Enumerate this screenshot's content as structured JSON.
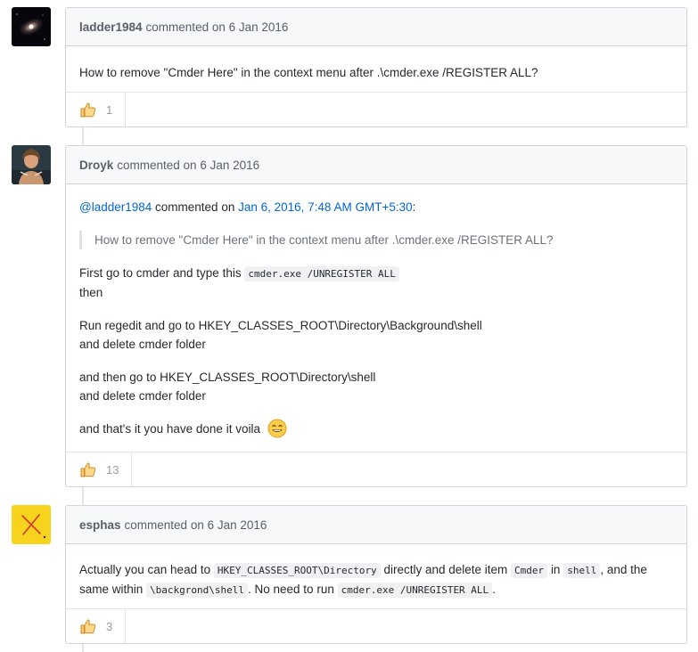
{
  "comments": [
    {
      "author": "ladder1984",
      "meta": "commented on 6 Jan 2016",
      "body_text": "How to remove \"Cmder Here\" in the context menu after .\\cmder.exe /REGISTER ALL?",
      "reaction": {
        "icon": "thumbs-up-icon",
        "count": "1"
      }
    },
    {
      "author": "Droyk",
      "meta": "commented on 6 Jan 2016",
      "reply": {
        "mention": "@ladder1984",
        "mid": "commented on",
        "date_link": "Jan 6, 2016, 7:48 AM GMT+5:30",
        "colon": ":"
      },
      "quote": "How to remove \"Cmder Here\" in the context menu after .\\cmder.exe /REGISTER ALL?",
      "p1_text": "First go to cmder and type this",
      "p1_code": "cmder.exe /UNREGISTER ALL",
      "p1_line2": "then",
      "p2_line1": "Run regedit and go to HKEY_CLASSES_ROOT\\Directory\\Background\\shell",
      "p2_line2": "and delete cmder folder",
      "p3_line1": "and then go to HKEY_CLASSES_ROOT\\Directory\\shell",
      "p3_line2": "and delete cmder folder",
      "p4_text": "and that's it you have done it voila",
      "p4_emoji": "smile-emoji",
      "reaction": {
        "icon": "thumbs-up-icon",
        "count": "13"
      }
    },
    {
      "author": "esphas",
      "meta": "commented on 6 Jan 2016",
      "t1": "Actually you can head to",
      "c1": "HKEY_CLASSES_ROOT\\Directory",
      "t2": "directly and delete item",
      "c2": "Cmder",
      "t3": "in",
      "c3": "shell",
      "t4": ", and the same within",
      "c4": "\\backgrond\\shell",
      "t5": ". No need to run",
      "c5": "cmder.exe /UNREGISTER ALL",
      "t6": ".",
      "reaction": {
        "icon": "thumbs-up-icon",
        "count": "3"
      }
    }
  ],
  "colors": {
    "link": "#0366d6",
    "header_bg": "#f6f8fa",
    "border": "#d1d5da",
    "thumb": "#f4c870"
  }
}
